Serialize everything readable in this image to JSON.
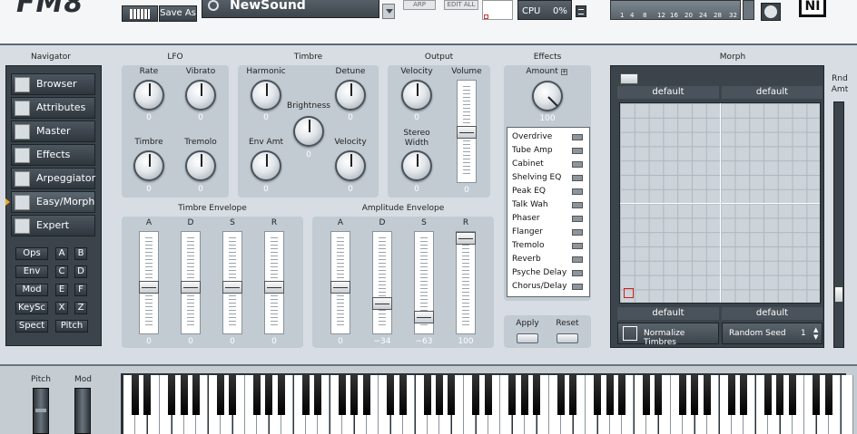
{
  "header": {
    "logo": "FM8",
    "save_as": "Save As",
    "preset_name": "NewSound",
    "arp": "ARP",
    "edit_all": "EDIT ALL",
    "cpu_label": "CPU",
    "cpu_value": "0%",
    "meter_ticks": [
      "1",
      "4",
      "8",
      "12",
      "16",
      "20",
      "24",
      "28",
      "32"
    ],
    "ni_logo": "NI"
  },
  "navigator": {
    "title": "Navigator",
    "items": [
      {
        "label": "Browser"
      },
      {
        "label": "Attributes"
      },
      {
        "label": "Master"
      },
      {
        "label": "Effects"
      },
      {
        "label": "Arpeggiator"
      },
      {
        "label": "Easy/Morph"
      },
      {
        "label": "Expert"
      }
    ],
    "small_buttons": [
      "Ops",
      "A",
      "B",
      "Env",
      "C",
      "D",
      "Mod",
      "E",
      "F",
      "KeySc",
      "X",
      "Z",
      "Spect",
      "Pitch"
    ]
  },
  "lfo": {
    "title": "LFO",
    "knobs": [
      {
        "label": "Rate",
        "value": "0"
      },
      {
        "label": "Vibrato",
        "value": "0"
      },
      {
        "label": "Timbre",
        "value": "0"
      },
      {
        "label": "Tremolo",
        "value": "0"
      }
    ]
  },
  "timbre": {
    "title": "Timbre",
    "knobs": [
      {
        "label": "Harmonic",
        "value": "0"
      },
      {
        "label": "Detune",
        "value": "0"
      },
      {
        "label": "Brightness",
        "value": "0"
      },
      {
        "label": "Env Amt",
        "value": "0"
      },
      {
        "label": "Velocity",
        "value": "0"
      }
    ]
  },
  "output": {
    "title": "Output",
    "knobs": [
      {
        "label": "Velocity",
        "value": "0"
      },
      {
        "label": "Stereo Width",
        "value": "0"
      }
    ],
    "volume_label": "Volume",
    "volume_value": "0"
  },
  "effects": {
    "title": "Effects",
    "amount_label": "Amount",
    "amount_value": "100",
    "list": [
      "Overdrive",
      "Tube Amp",
      "Cabinet",
      "Shelving EQ",
      "Peak EQ",
      "Talk Wah",
      "Phaser",
      "Flanger",
      "Tremolo",
      "Reverb",
      "Psyche Delay",
      "Chorus/Delay"
    ],
    "apply": "Apply",
    "reset": "Reset"
  },
  "timbre_env": {
    "title": "Timbre Envelope",
    "sliders": [
      {
        "label": "A",
        "value": "0",
        "level": 0.45
      },
      {
        "label": "D",
        "value": "0",
        "level": 0.45
      },
      {
        "label": "S",
        "value": "0",
        "level": 0.45
      },
      {
        "label": "R",
        "value": "0",
        "level": 0.45
      }
    ]
  },
  "amp_env": {
    "title": "Amplitude Envelope",
    "sliders": [
      {
        "label": "A",
        "value": "0",
        "level": 0.45
      },
      {
        "label": "D",
        "value": "−34",
        "level": 0.27
      },
      {
        "label": "S",
        "value": "−63",
        "level": 0.11
      },
      {
        "label": "R",
        "value": "100",
        "level": 1.0
      }
    ]
  },
  "morph": {
    "title": "Morph",
    "rnd_amt": "Rnd Amt",
    "corners": [
      "default",
      "default",
      "default",
      "default"
    ],
    "normalize": "Normalize Timbres",
    "random_seed_label": "Random Seed",
    "random_seed_value": "1"
  },
  "keyboard": {
    "pitch": "Pitch",
    "mod": "Mod"
  }
}
